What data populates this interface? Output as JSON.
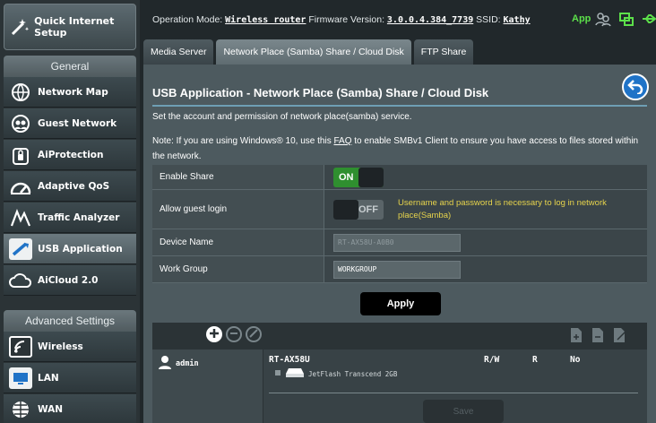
{
  "sidebar": {
    "quick_setup": "Quick Internet Setup",
    "general_header": "General",
    "general_items": [
      {
        "label": "Network Map",
        "icon": "network-map-icon"
      },
      {
        "label": "Guest Network",
        "icon": "guest-network-icon"
      },
      {
        "label": "AiProtection",
        "icon": "lock-icon"
      },
      {
        "label": "Adaptive QoS",
        "icon": "speedometer-icon"
      },
      {
        "label": "Traffic Analyzer",
        "icon": "traffic-analyzer-icon"
      },
      {
        "label": "USB Application",
        "icon": "usb-icon",
        "active": true
      },
      {
        "label": "AiCloud 2.0",
        "icon": "cloud-icon"
      }
    ],
    "advanced_header": "Advanced Settings",
    "advanced_items": [
      {
        "label": "Wireless",
        "icon": "wifi-icon"
      },
      {
        "label": "LAN",
        "icon": "lan-icon"
      },
      {
        "label": "WAN",
        "icon": "globe-icon"
      }
    ]
  },
  "topbar": {
    "op_mode_label": "Operation Mode:",
    "op_mode_value": "Wireless router",
    "firmware_label": "Firmware Version:",
    "firmware_value": "3.0.0.4.384_7739",
    "ssid_label": "SSID:",
    "ssid_value": "Kathy",
    "app_label": "App"
  },
  "tabs": [
    {
      "label": "Media Server",
      "active": false
    },
    {
      "label": "Network Place (Samba) Share / Cloud Disk",
      "active": true
    },
    {
      "label": "FTP Share",
      "active": false
    }
  ],
  "main": {
    "title": "USB Application - Network Place (Samba) Share / Cloud Disk",
    "description": "Set the account and permission of network place(samba) service.",
    "note_before": "Note: If you are using Windows® 10, use this ",
    "note_link": "FAQ",
    "note_after": " to enable SMBv1 Client to ensure you have access to files stored within the network.",
    "form": {
      "enable_share_label": "Enable Share",
      "enable_share_state": "ON",
      "guest_login_label": "Allow guest login",
      "guest_login_state": "OFF",
      "guest_login_hint": "Username and password is necessary to log in network place(Samba)",
      "device_name_label": "Device Name",
      "device_name_placeholder": "RT-AX58U-A0B0",
      "work_group_label": "Work Group",
      "work_group_value": "WORKGROUP"
    },
    "apply_label": "Apply",
    "panel": {
      "account_name": "admin",
      "device": "RT-AX58U",
      "col_rw": "R/W",
      "col_r": "R",
      "col_no": "No",
      "folder_name": "JetFlash Transcend 2GB",
      "save_label": "Save"
    }
  },
  "colors": {
    "accent_green": "#2f8f2f",
    "hint_yellow": "#e6d34c",
    "app_green": "#5ce04a",
    "back_blue": "#1f73c7"
  }
}
